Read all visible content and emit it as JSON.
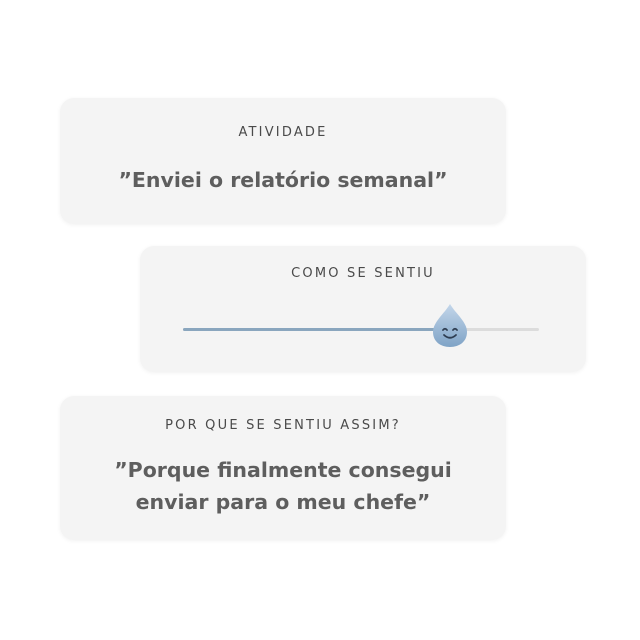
{
  "activity": {
    "label": "ATIVIDADE",
    "text": "”Enviei o relatório semanal”"
  },
  "feeling": {
    "label": "COMO SE SENTIU",
    "slider_value": 0.75,
    "thumb_icon": "smiling-droplet-icon",
    "accent_color": "#8aa6be",
    "track_color": "#dcdcdc"
  },
  "reason": {
    "label": "POR QUE SE SENTIU ASSIM?",
    "line1": "”Porque finalmente consegui",
    "line2": "enviar para o meu chefe”"
  }
}
